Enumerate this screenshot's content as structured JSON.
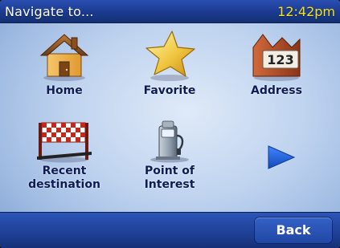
{
  "header": {
    "title": "Navigate to...",
    "time": "12:42pm"
  },
  "menu": {
    "items": [
      {
        "label": "Home",
        "icon": "home-icon"
      },
      {
        "label": "Favorite",
        "icon": "star-icon"
      },
      {
        "label": "Address",
        "icon": "address-icon"
      },
      {
        "label": "Recent\ndestination",
        "icon": "checkered-flag-icon"
      },
      {
        "label": "Point of\nInterest",
        "icon": "fuel-pump-icon"
      }
    ],
    "next_icon": "next-arrow-icon"
  },
  "footer": {
    "back_label": "Back"
  },
  "colors": {
    "title_bar": "#1b3a90",
    "clock_text": "#f3e31b",
    "label_text": "#0d1b55",
    "background": "#bfd3ef",
    "arrow": "#1f5fd0"
  }
}
